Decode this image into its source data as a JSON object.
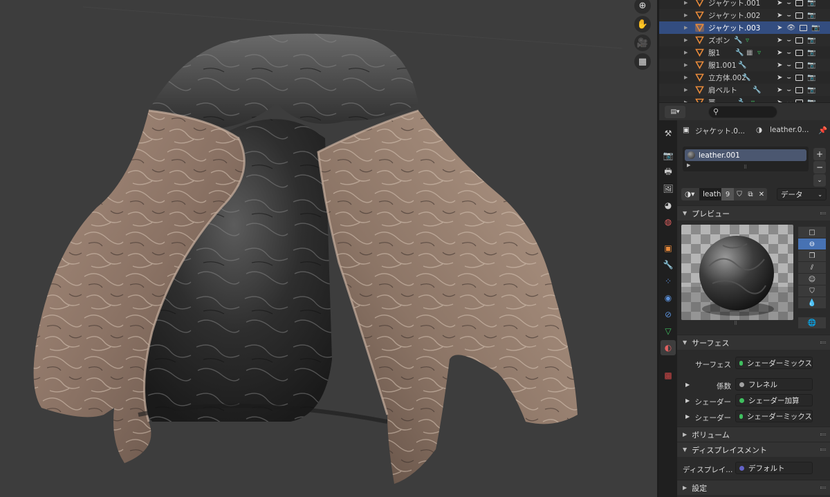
{
  "outliner": {
    "rows": [
      {
        "name": "ジャケット.001",
        "active": false
      },
      {
        "name": "ジャケット.002",
        "active": false
      },
      {
        "name": "ジャケット.003",
        "active": true
      },
      {
        "name": "ズボン",
        "active": false
      },
      {
        "name": "服1",
        "active": false
      },
      {
        "name": "服1.001",
        "active": false
      },
      {
        "name": "立方体.002",
        "active": false
      },
      {
        "name": "肩ベルト",
        "active": false
      },
      {
        "name": "帯",
        "active": false
      }
    ]
  },
  "viewport": {
    "nav_icons": [
      "zoom-icon",
      "hand-icon",
      "camera-icon",
      "grid-icon"
    ]
  },
  "properties": {
    "breadcrumb_object": "ジャケット.0...",
    "breadcrumb_material": "leather.0...",
    "slot_name": "leather.001",
    "material_name": "leath",
    "user_count": "9",
    "link_mode": "データ",
    "panels": {
      "preview": "プレビュー",
      "surface": "サーフェス",
      "volume": "ボリューム",
      "displacement": "ディスプレイスメント",
      "settings": "設定"
    },
    "surface_rows": [
      {
        "label": "サーフェス",
        "value": "シェーダーミックス",
        "dot_color": "#3fbf5f",
        "expandable": false
      },
      {
        "label": "係数",
        "value": "フレネル",
        "dot_color": "#a1a1a1",
        "expandable": true
      },
      {
        "label": "シェーダー",
        "value": "シェーダー加算",
        "dot_color": "#3fbf5f",
        "expandable": true
      },
      {
        "label": "シェーダー",
        "value": "シェーダーミックス",
        "dot_color": "#3fbf5f",
        "expandable": true
      }
    ],
    "displacement_row": {
      "label": "ディスプレイ...",
      "value": "デフォルト",
      "dot_color": "#6363c7"
    }
  },
  "colors": {
    "accent_blue": "#4772b3",
    "active_row": "#334d80",
    "object_orange": "#e88a3a"
  }
}
